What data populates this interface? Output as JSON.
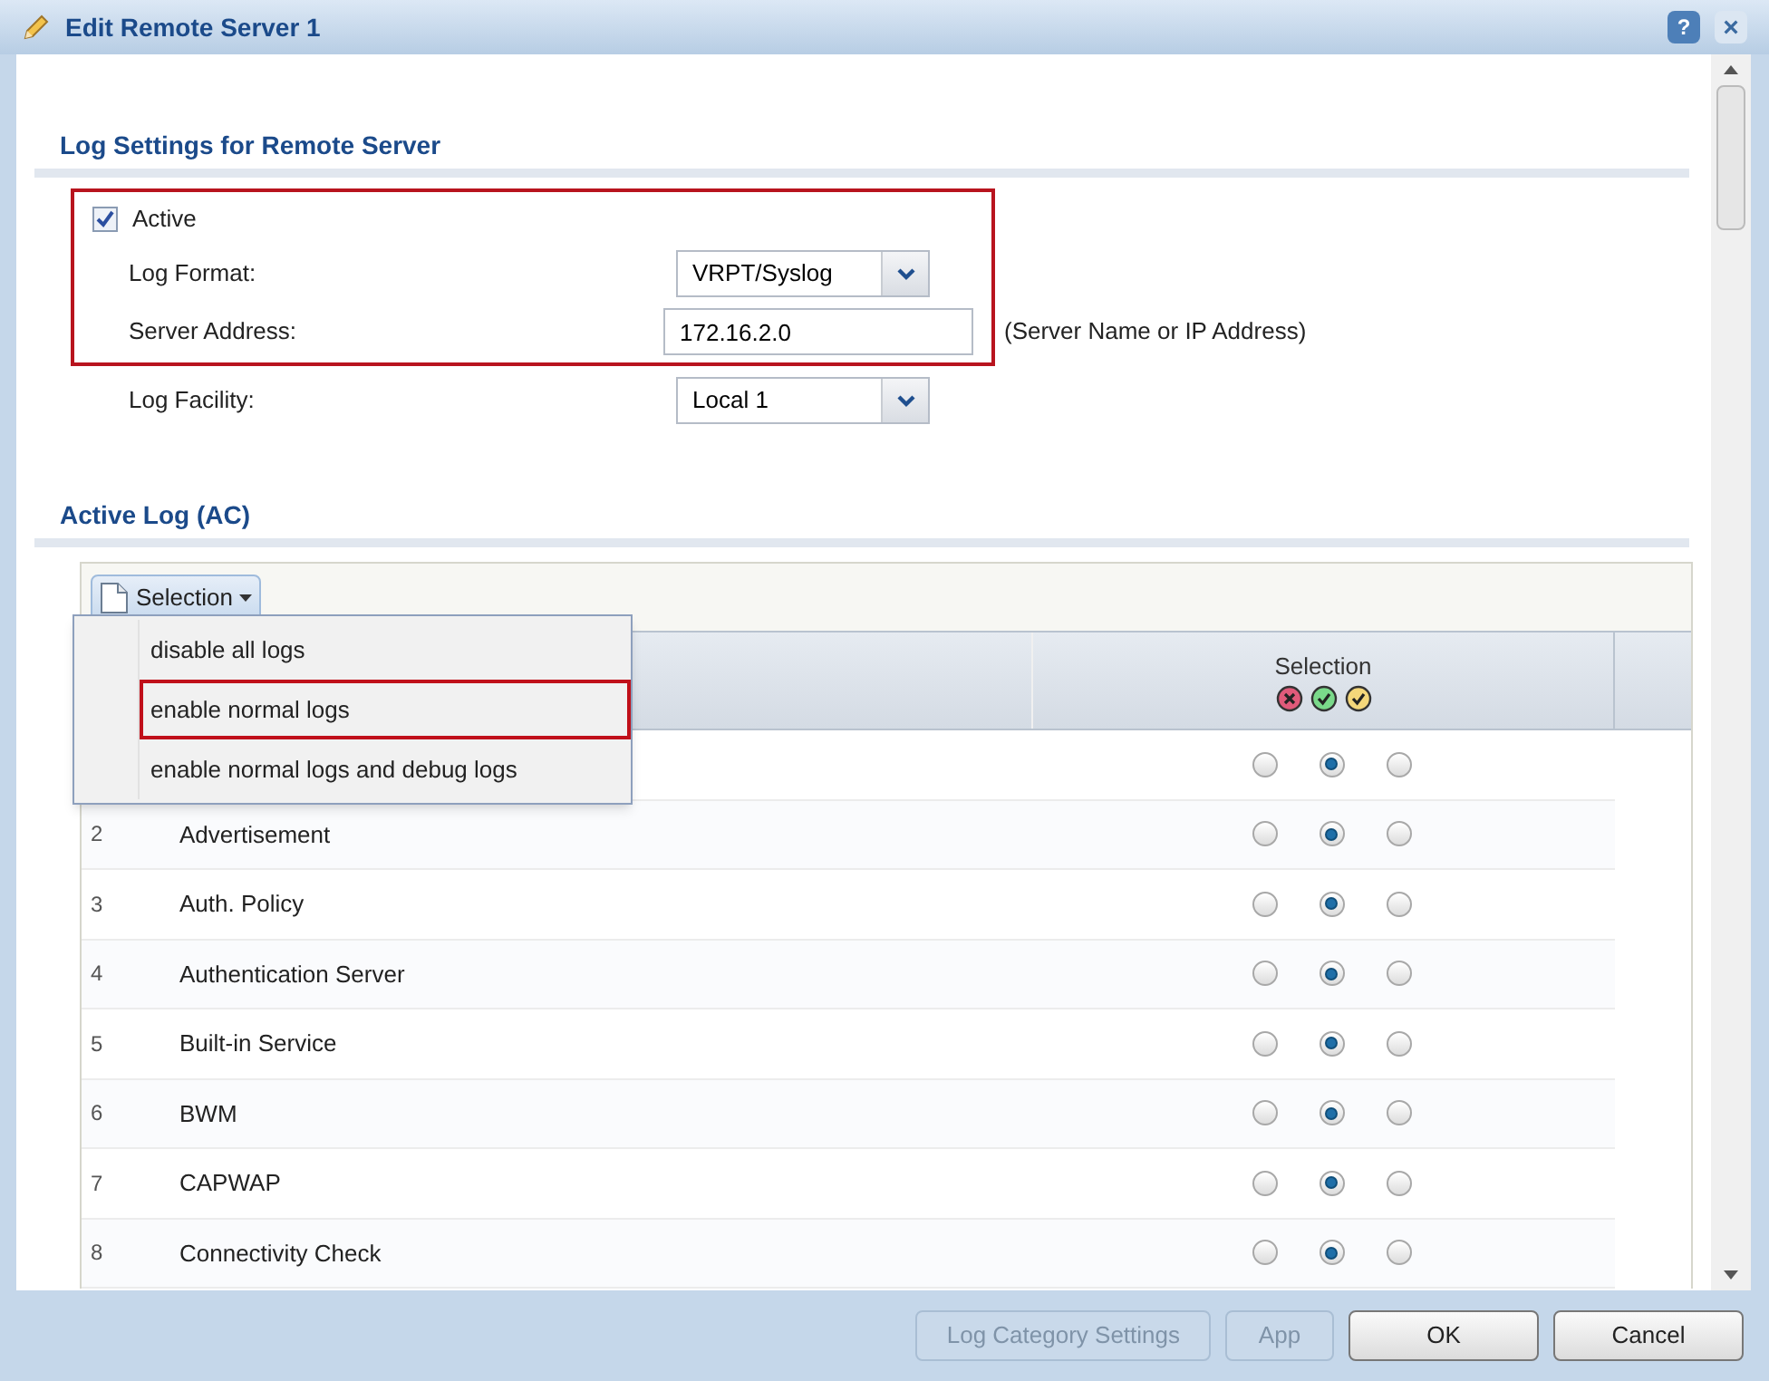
{
  "window": {
    "title": "Edit Remote Server 1",
    "help": "?",
    "close": "×"
  },
  "log_settings": {
    "heading": "Log Settings for Remote Server",
    "active": {
      "label": "Active",
      "checked": true
    },
    "log_format": {
      "label": "Log Format:",
      "value": "VRPT/Syslog"
    },
    "server_address": {
      "label": "Server Address:",
      "value": "172.16.2.0",
      "hint": "(Server Name or IP Address)"
    },
    "log_facility": {
      "label": "Log Facility:",
      "value": "Local 1"
    }
  },
  "active_log": {
    "heading": "Active Log (AC)",
    "toolbar": {
      "selection_button": "Selection"
    },
    "menu": {
      "items": [
        {
          "label": "disable all logs",
          "highlighted": false
        },
        {
          "label": "enable normal logs",
          "highlighted": true
        },
        {
          "label": "enable normal logs and debug logs",
          "highlighted": false
        }
      ]
    },
    "table": {
      "columns": {
        "selection": "Selection"
      },
      "rows": [
        {
          "options": [
            {
              "selected": false
            },
            {
              "selected": true
            },
            {
              "selected": false
            }
          ]
        },
        {
          "number": "2",
          "name": "Advertisement",
          "options": [
            {
              "selected": false
            },
            {
              "selected": true
            },
            {
              "selected": false
            }
          ]
        },
        {
          "number": "3",
          "name": "Auth. Policy",
          "options": [
            {
              "selected": false
            },
            {
              "selected": true
            },
            {
              "selected": false
            }
          ]
        },
        {
          "number": "4",
          "name": "Authentication Server",
          "options": [
            {
              "selected": false
            },
            {
              "selected": true
            },
            {
              "selected": false
            }
          ]
        },
        {
          "number": "5",
          "name": "Built-in Service",
          "options": [
            {
              "selected": false
            },
            {
              "selected": true
            },
            {
              "selected": false
            }
          ]
        },
        {
          "number": "6",
          "name": "BWM",
          "options": [
            {
              "selected": false
            },
            {
              "selected": true
            },
            {
              "selected": false
            }
          ]
        },
        {
          "number": "7",
          "name": "CAPWAP",
          "options": [
            {
              "selected": false
            },
            {
              "selected": true
            },
            {
              "selected": false
            }
          ]
        },
        {
          "number": "8",
          "name": "Connectivity Check",
          "options": [
            {
              "selected": false
            },
            {
              "selected": true
            },
            {
              "selected": false
            }
          ]
        }
      ]
    }
  },
  "footer": {
    "buttons": [
      {
        "label": "Log Category Settings",
        "disabled": true
      },
      {
        "label": "App",
        "disabled": true
      },
      {
        "label": "OK",
        "disabled": false
      },
      {
        "label": "Cancel",
        "disabled": false
      }
    ]
  }
}
